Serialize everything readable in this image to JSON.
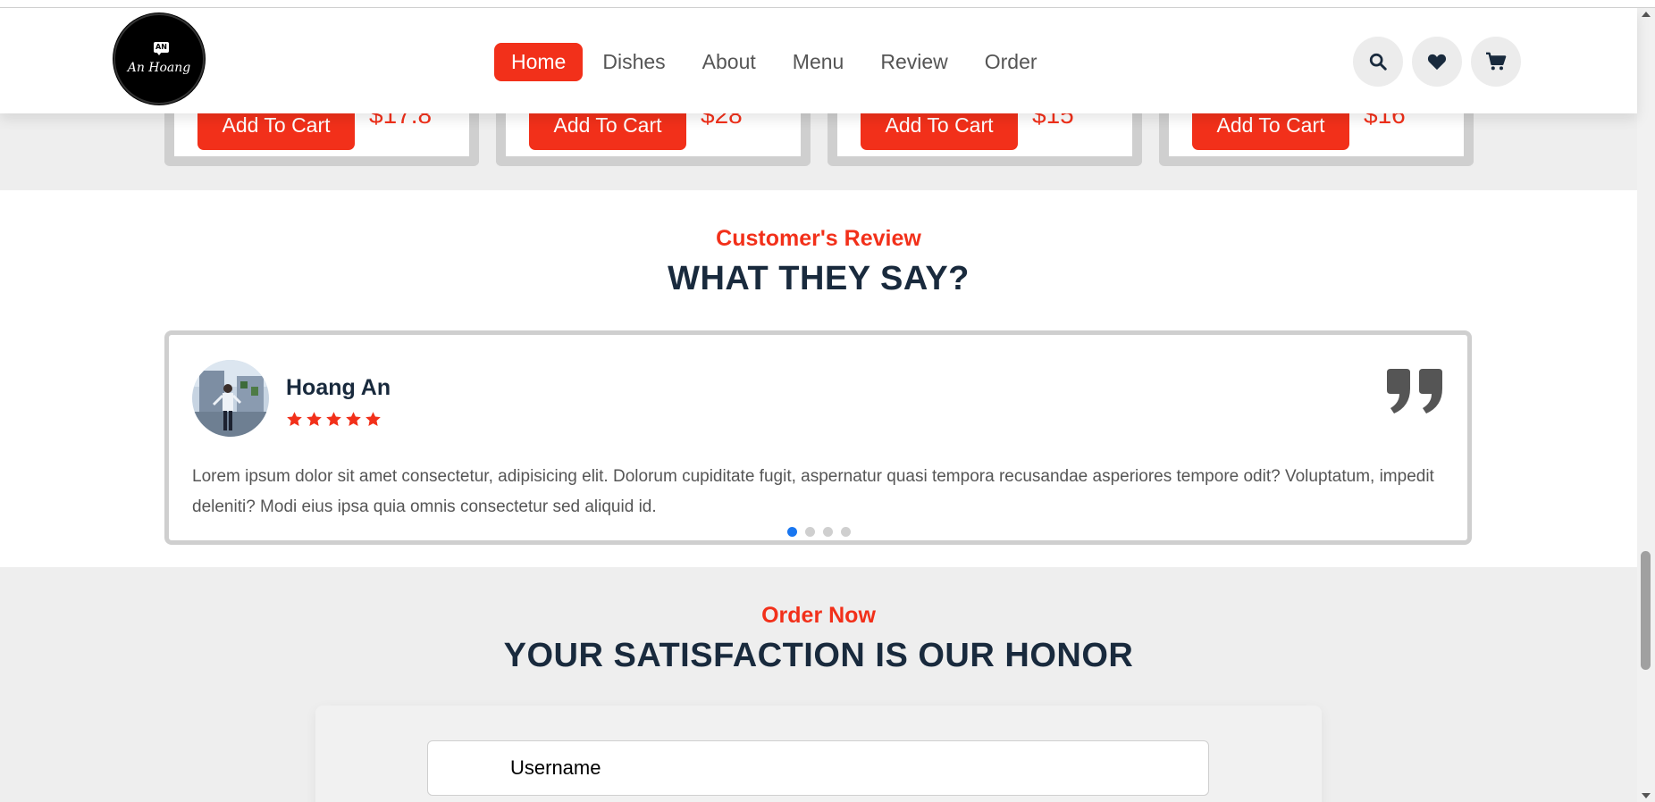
{
  "header": {
    "logo": {
      "badge": "AN",
      "text": "An Hoang"
    },
    "nav": [
      {
        "label": "Home",
        "active": true
      },
      {
        "label": "Dishes",
        "active": false
      },
      {
        "label": "About",
        "active": false
      },
      {
        "label": "Menu",
        "active": false
      },
      {
        "label": "Review",
        "active": false
      },
      {
        "label": "Order",
        "active": false
      }
    ],
    "icons": [
      "search-icon",
      "heart-icon",
      "cart-icon"
    ]
  },
  "products": [
    {
      "button_label": "Add To Cart",
      "price": "$17.8"
    },
    {
      "button_label": "Add To Cart",
      "price": "$28"
    },
    {
      "button_label": "Add To Cart",
      "price": "$15"
    },
    {
      "button_label": "Add To Cart",
      "price": "$16"
    }
  ],
  "review_section": {
    "subtitle": "Customer's Review",
    "title": "WHAT THEY SAY?",
    "review": {
      "name": "Hoang An",
      "stars": 5,
      "text": "Lorem ipsum dolor sit amet consectetur, adipisicing elit. Dolorum cupiditate fugit, aspernatur quasi tempora recusandae asperiores tempore odit? Voluptatum, impedit deleniti? Modi eius ipsa quia omnis consectetur sed aliquid id."
    },
    "pagination": {
      "total": 4,
      "active_index": 0
    }
  },
  "order_section": {
    "subtitle": "Order Now",
    "title": "YOUR SATISFACTION IS OUR HONOR",
    "username_placeholder": "Username"
  },
  "colors": {
    "accent": "#f2301a",
    "heading": "#192a3d",
    "section_bg": "#eeeeee",
    "active_dot": "#1976f0"
  }
}
